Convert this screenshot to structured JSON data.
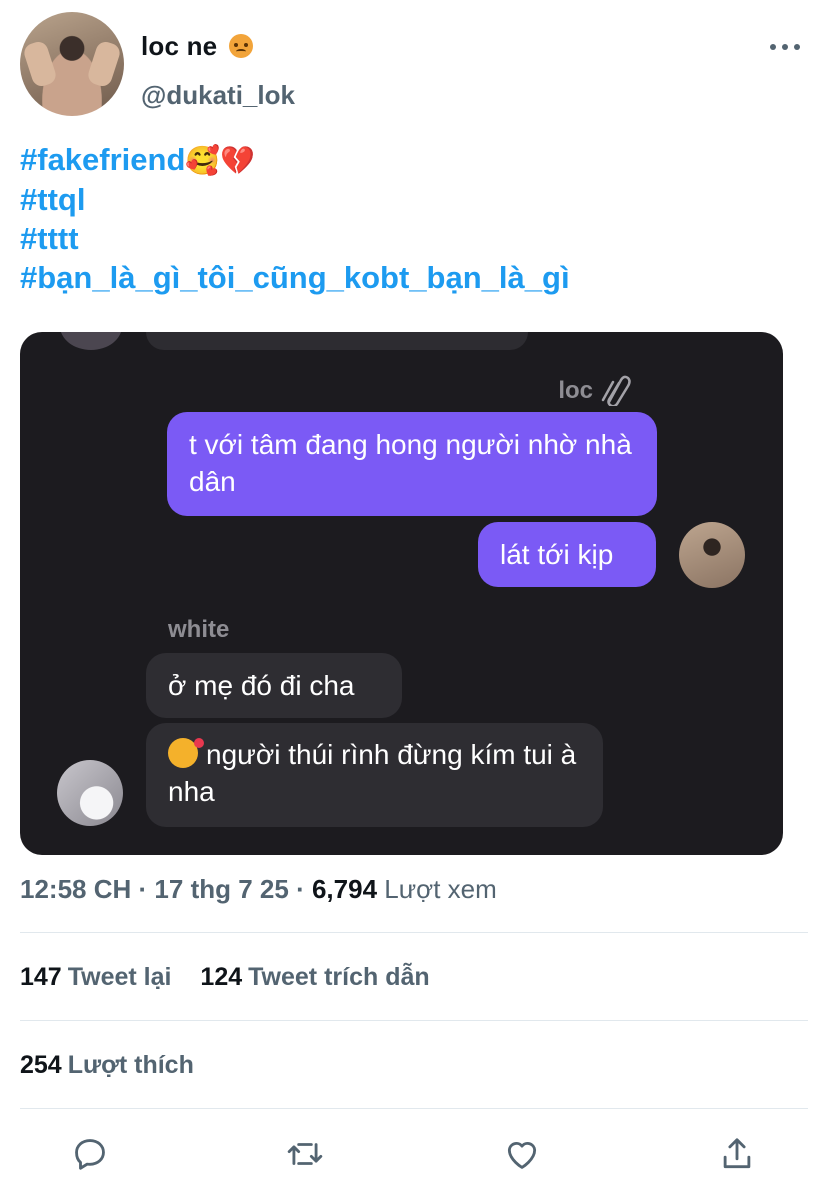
{
  "author": {
    "display_name": "loc ne",
    "handle": "@dukati_lok",
    "name_emoji_icon": "angry-face-icon"
  },
  "tweet": {
    "hashtags": [
      "#fakefriend",
      "#ttql",
      "#tttt",
      "#bạn_là_gì_tôi_cũng_kobt_bạn_là_gì"
    ],
    "first_hashtag_emojis": "🥰💔"
  },
  "chat_image": {
    "sender_loc": "loc",
    "sender_white": "white",
    "messages": [
      {
        "from": "loc",
        "text": "t với tâm đang hong người nhờ nhà dân"
      },
      {
        "from": "loc",
        "text": "lát tới kịp"
      },
      {
        "from": "white",
        "text": "ở mẹ đó đi cha"
      },
      {
        "from": "white",
        "text": "người thúi rình đừng kím tui à nha"
      }
    ],
    "colors": {
      "background": "#1c1b1f",
      "my_bubble": "#7b5af5",
      "their_bubble": "#2e2d32"
    }
  },
  "meta": {
    "time": "12:58 CH",
    "separator1": "·",
    "date": "17 thg 7 25",
    "separator2": "·",
    "views_count": "6,794",
    "views_label": "Lượt xem"
  },
  "stats": {
    "retweets_count": "147",
    "retweets_label": "Tweet lại",
    "quotes_count": "124",
    "quotes_label": "Tweet trích dẫn",
    "likes_count": "254",
    "likes_label": "Lượt thích"
  },
  "actions": [
    "reply-icon",
    "retweet-icon",
    "like-icon",
    "share-icon"
  ],
  "colors": {
    "accent": "#1d9bf0",
    "secondary_text": "#536471",
    "divider": "#e1e8ed"
  }
}
